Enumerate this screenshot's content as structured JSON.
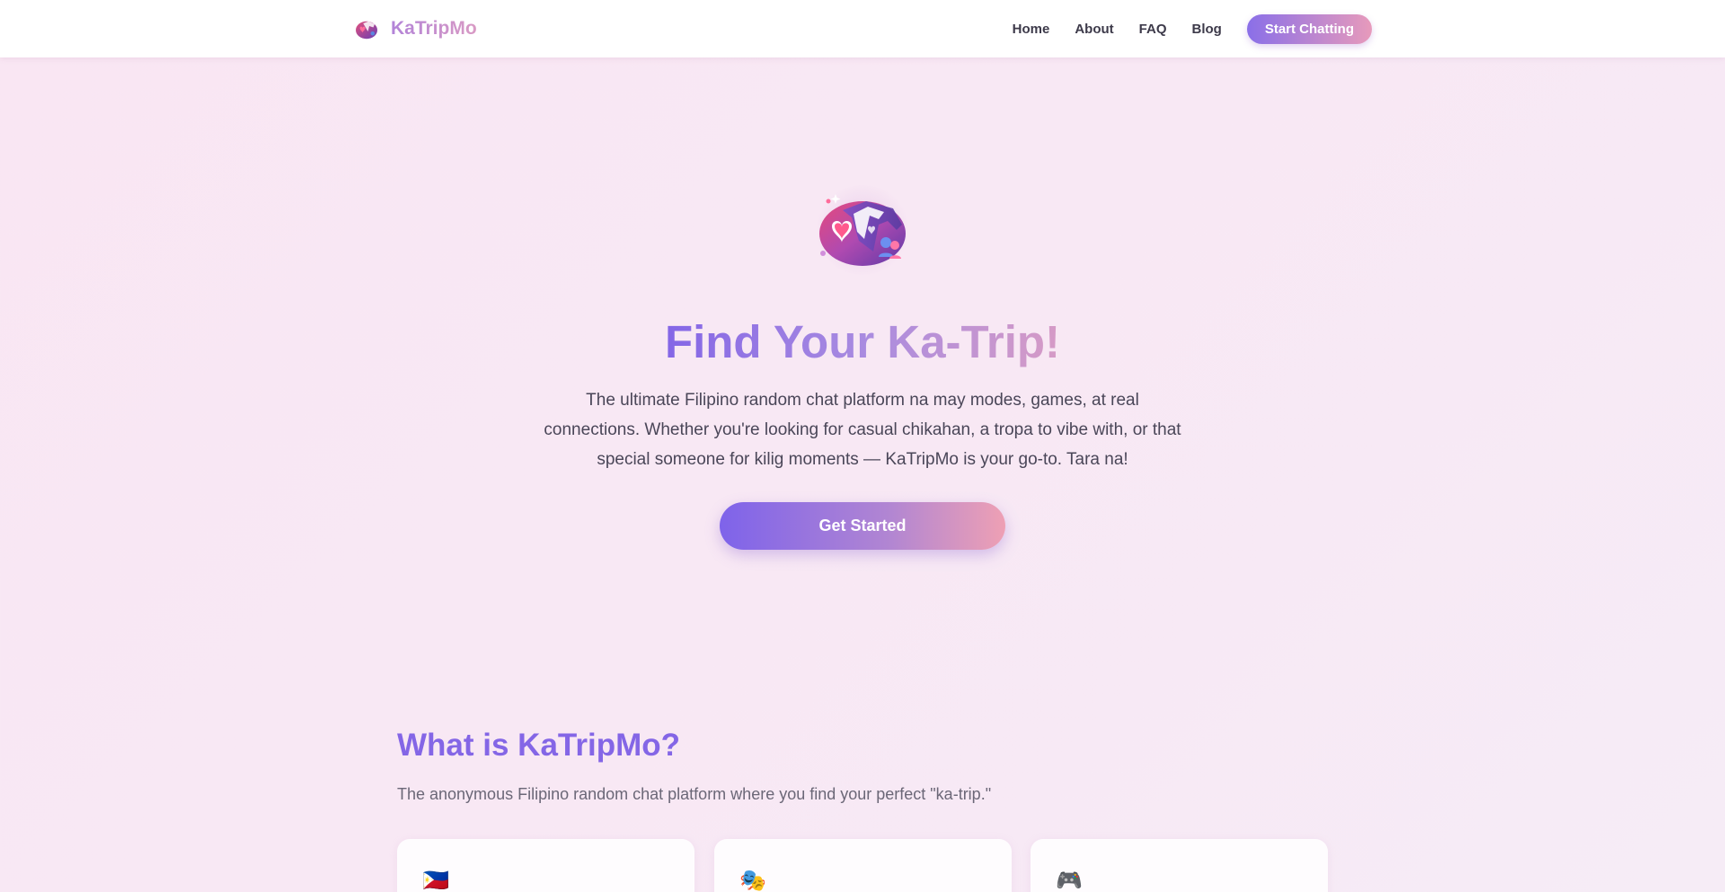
{
  "header": {
    "brand_name": "KaTripMo",
    "nav": [
      "Home",
      "About",
      "FAQ",
      "Blog"
    ],
    "cta_label": "Start Chatting"
  },
  "hero": {
    "title": "Find Your Ka-Trip!",
    "description": "The ultimate Filipino random chat platform na may modes, games, at real connections. Whether you're looking for casual chikahan, a tropa to vibe with, or that special someone for kilig moments — KaTripMo is your go-to. Tara na!",
    "cta_label": "Get Started"
  },
  "about": {
    "title": "What is KaTripMo?",
    "subtitle": "The anonymous Filipino random chat platform where you find your perfect \"ka-trip.\"",
    "cards": [
      {
        "icon": "🇵🇭"
      },
      {
        "icon": "🎭"
      },
      {
        "icon": "🎮"
      }
    ]
  },
  "colors": {
    "accent_purple": "#8466e6",
    "accent_pink": "#e79abb",
    "background": "#f9e6f3"
  }
}
